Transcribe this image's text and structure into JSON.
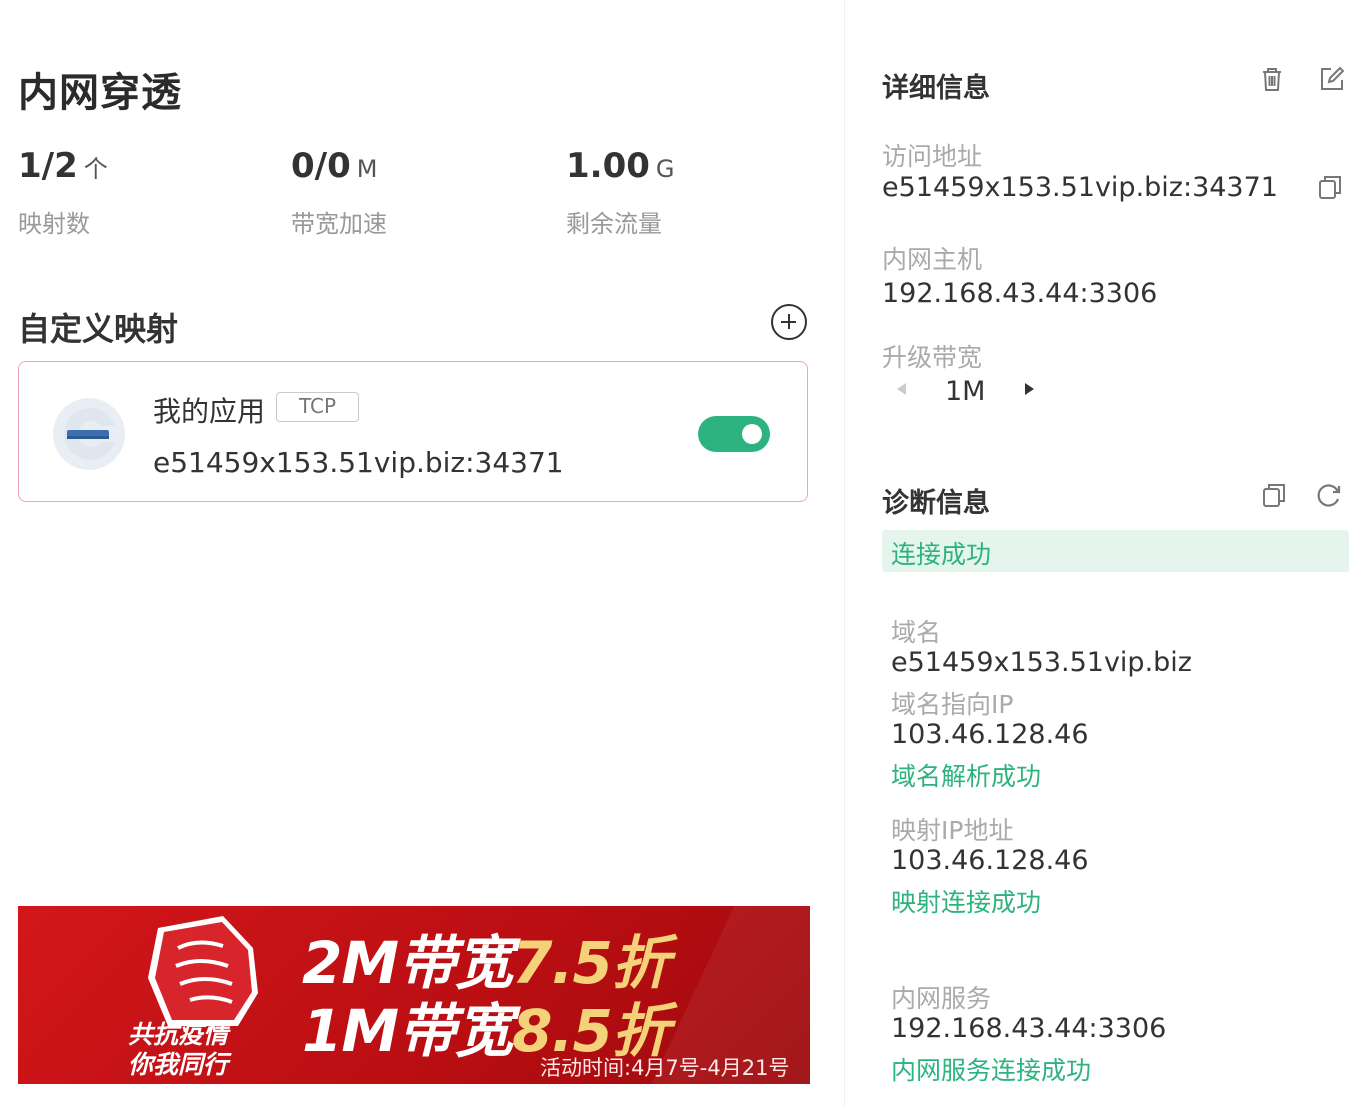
{
  "page": {
    "title": "内网穿透"
  },
  "stats": [
    {
      "value": "1/2",
      "unit": "个",
      "label": "映射数"
    },
    {
      "value": "0/0",
      "unit": "M",
      "label": "带宽加速"
    },
    {
      "value": "1.00",
      "unit": "G",
      "label": "剩余流量"
    }
  ],
  "mappings": {
    "title": "自定义映射",
    "items": [
      {
        "name": "我的应用",
        "protocol": "TCP",
        "address": "e51459x153.51vip.biz:34371",
        "enabled": true
      }
    ]
  },
  "banner": {
    "slogan_line1": "共抗疫情",
    "slogan_line2": "你我同行",
    "promo1_prefix": "2M带宽",
    "promo1_discount": "7.5折",
    "promo2_prefix": "1M带宽",
    "promo2_discount": "8.5折",
    "time": "活动时间:4月7号-4月21号"
  },
  "details": {
    "title": "详细信息",
    "access_label": "访问地址",
    "access_value": "e51459x153.51vip.biz:34371",
    "host_label": "内网主机",
    "host_value": "192.168.43.44:3306",
    "bandwidth_label": "升级带宽",
    "bandwidth_value": "1M"
  },
  "diagnostics": {
    "title": "诊断信息",
    "status": "连接成功",
    "domain_label": "域名",
    "domain_value": "e51459x153.51vip.biz",
    "domain_ip_label": "域名指向IP",
    "domain_ip_value": "103.46.128.46",
    "domain_ip_status": "域名解析成功",
    "map_ip_label": "映射IP地址",
    "map_ip_value": "103.46.128.46",
    "map_ip_status": "映射连接成功",
    "service_label": "内网服务",
    "service_value": "192.168.43.44:3306",
    "service_status": "内网服务连接成功"
  },
  "colors": {
    "accent_green": "#2db37f",
    "card_border": "#e8a6bd",
    "banner_red": "#d3171b",
    "banner_gold": "#f4d27a"
  }
}
